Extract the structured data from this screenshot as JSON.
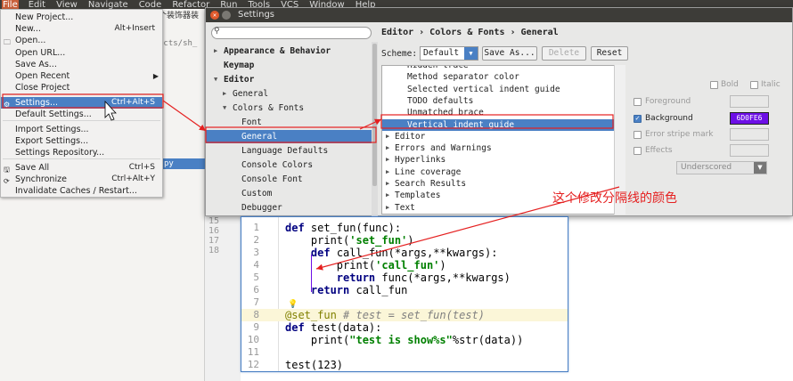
{
  "ide": {
    "menubar": [
      "File",
      "Edit",
      "View",
      "Navigate",
      "Code",
      "Refactor",
      "Run",
      "Tools",
      "VCS",
      "Window",
      "Help"
    ],
    "tab_fragment": "个装饰器装",
    "path_fragment": "ects/sh_",
    "selected_file_fragment": "py",
    "gutter_lines": [
      "15",
      "16",
      "17",
      "18"
    ]
  },
  "file_menu": {
    "items": [
      {
        "label": "New Project...",
        "shortcut": "",
        "icon": ""
      },
      {
        "label": "New...",
        "shortcut": "Alt+Insert",
        "icon": ""
      },
      {
        "label": "Open...",
        "shortcut": "",
        "icon": "folder-icon"
      },
      {
        "label": "Open URL...",
        "shortcut": "",
        "icon": ""
      },
      {
        "label": "Save As...",
        "shortcut": "",
        "icon": ""
      },
      {
        "label": "Open Recent",
        "shortcut": "",
        "icon": "",
        "submenu": true
      },
      {
        "label": "Close Project",
        "shortcut": "",
        "icon": ""
      },
      {
        "label": "Settings...",
        "shortcut": "Ctrl+Alt+S",
        "icon": "settings-icon",
        "highlighted": true
      },
      {
        "label": "Default Settings...",
        "shortcut": "",
        "icon": ""
      },
      {
        "label": "Import Settings...",
        "shortcut": "",
        "icon": ""
      },
      {
        "label": "Export Settings...",
        "shortcut": "",
        "icon": ""
      },
      {
        "label": "Settings Repository...",
        "shortcut": "",
        "icon": ""
      },
      {
        "label": "Save All",
        "shortcut": "Ctrl+S",
        "icon": "save-icon"
      },
      {
        "label": "Synchronize",
        "shortcut": "Ctrl+Alt+Y",
        "icon": "sync-icon"
      },
      {
        "label": "Invalidate Caches / Restart...",
        "shortcut": "",
        "icon": ""
      }
    ]
  },
  "settings": {
    "title": "Settings",
    "search_placeholder": "",
    "nav": [
      {
        "label": "Appearance & Behavior",
        "level": 0,
        "bold": true,
        "twisty": "▶"
      },
      {
        "label": "Keymap",
        "level": 0,
        "bold": true,
        "twisty": ""
      },
      {
        "label": "Editor",
        "level": 0,
        "bold": true,
        "twisty": "▼"
      },
      {
        "label": "General",
        "level": 1,
        "bold": false,
        "twisty": "▶"
      },
      {
        "label": "Colors & Fonts",
        "level": 1,
        "bold": false,
        "twisty": "▼"
      },
      {
        "label": "Font",
        "level": 2,
        "bold": false,
        "twisty": ""
      },
      {
        "label": "General",
        "level": 2,
        "bold": false,
        "twisty": "",
        "selected": true
      },
      {
        "label": "Language Defaults",
        "level": 2,
        "bold": false,
        "twisty": ""
      },
      {
        "label": "Console Colors",
        "level": 2,
        "bold": false,
        "twisty": ""
      },
      {
        "label": "Console Font",
        "level": 2,
        "bold": false,
        "twisty": ""
      },
      {
        "label": "Custom",
        "level": 2,
        "bold": false,
        "twisty": ""
      },
      {
        "label": "Debugger",
        "level": 2,
        "bold": false,
        "twisty": ""
      }
    ],
    "breadcrumb": "Editor › Colors & Fonts › General",
    "scheme_label": "Scheme:",
    "scheme_value": "Default",
    "buttons": {
      "save_as": "Save As...",
      "delete": "Delete",
      "reset": "Reset"
    },
    "attributes": [
      {
        "label": "Hidden trace",
        "twisty": "",
        "cut": true
      },
      {
        "label": "Method separator color",
        "twisty": ""
      },
      {
        "label": "Selected vertical indent guide",
        "twisty": ""
      },
      {
        "label": "TODO defaults",
        "twisty": ""
      },
      {
        "label": "Unmatched brace",
        "twisty": ""
      },
      {
        "label": "Vertical indent guide",
        "twisty": "",
        "selected": true
      },
      {
        "label": "Editor",
        "twisty": "▶"
      },
      {
        "label": "Errors and Warnings",
        "twisty": "▶"
      },
      {
        "label": "Hyperlinks",
        "twisty": "▶"
      },
      {
        "label": "Line coverage",
        "twisty": "▶"
      },
      {
        "label": "Search Results",
        "twisty": "▶"
      },
      {
        "label": "Templates",
        "twisty": "▶"
      },
      {
        "label": "Text",
        "twisty": "▶"
      }
    ],
    "props": {
      "bold": "Bold",
      "italic": "Italic",
      "foreground": "Foreground",
      "background": "Background",
      "background_checked": true,
      "background_value": "6D0FE6",
      "error_stripe": "Error stripe mark",
      "effects": "Effects",
      "effect_type": "Underscored"
    }
  },
  "preview": {
    "lines": [
      {
        "n": "1",
        "html": "<span class='kw'>def</span> set_fun(func):"
      },
      {
        "n": "2",
        "html": "    print(<span class='str'>'set_fun'</span>)"
      },
      {
        "n": "3",
        "html": "    <span class='kw'>def</span> call_fun(*args,**kwargs):"
      },
      {
        "n": "4",
        "html": "        print(<span class='str'>'call_fun'</span>)"
      },
      {
        "n": "5",
        "html": "        <span class='kw'>return</span> func(*args,**kwargs)"
      },
      {
        "n": "6",
        "html": "    <span class='kw'>return</span> call_fun"
      },
      {
        "n": "7",
        "html": ""
      },
      {
        "n": "8",
        "html": "<span class='dec'>@set_fun</span> <span class='cmt'># test = set_fun(test)</span>",
        "caret": true
      },
      {
        "n": "9",
        "html": "<span class='kw'>def</span> test(data):"
      },
      {
        "n": "10",
        "html": "    print(<span class='str'>\"test is show%s\"</span>%str(data))"
      },
      {
        "n": "11",
        "html": ""
      },
      {
        "n": "12",
        "html": "test(123)"
      }
    ]
  },
  "annotation": "这个修改分隔线的颜色",
  "colors": {
    "accent": "#4a80c4",
    "guide": "#6d0fe6",
    "arrow": "#e52020"
  }
}
